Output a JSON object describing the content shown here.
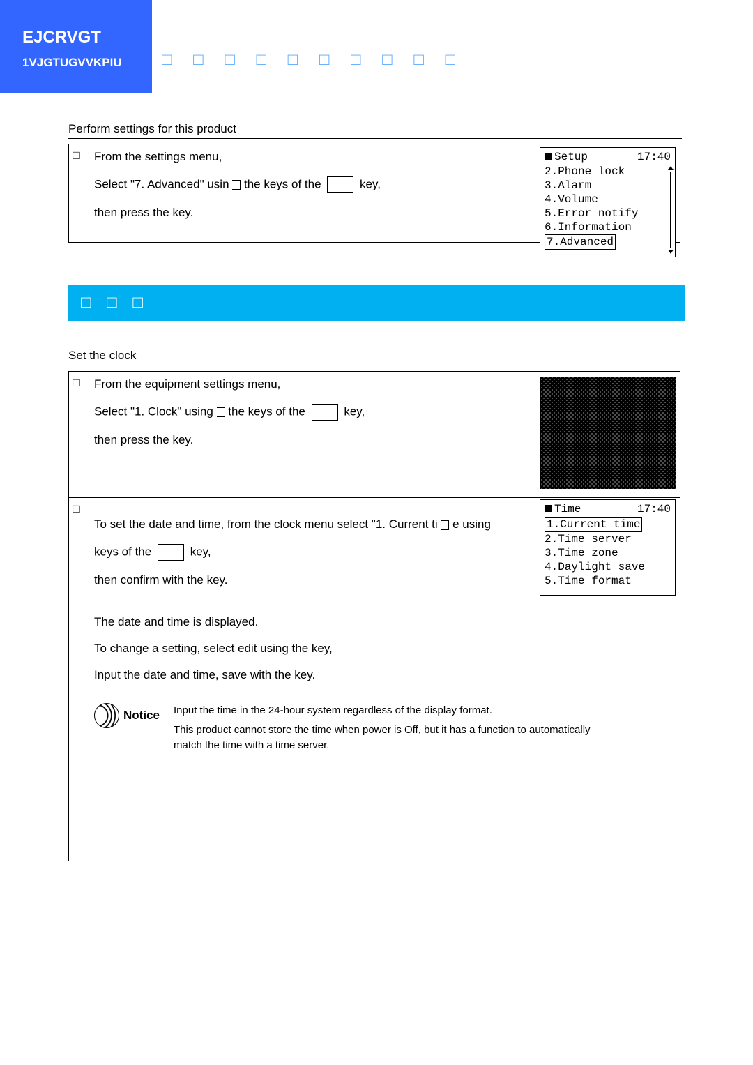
{
  "header": {
    "chapter_garbled": "EJCRVGT\u0019",
    "sub_garbled": "1VJGT\u0002UGVVKPIU"
  },
  "heading_boxes": "□ □ □ □ □ □ □ □ □ □",
  "section1": {
    "intro": "Perform settings for this product",
    "step_num": "□",
    "line1": "From the settings menu,",
    "line2a": "Select \"7. Advanced\" usin",
    "line2b": "the keys of the",
    "line2c": "key,",
    "line3": "then press the  key.",
    "phone": {
      "title": "Setup",
      "time": "17:40",
      "items": [
        "2.Phone lock",
        "3.Alarm",
        "4.Volume",
        "5.Error notify",
        "6.Information",
        "7.Advanced"
      ]
    }
  },
  "clock_bar": "□ □ □",
  "section2": {
    "intro": "Set the clock",
    "row1": {
      "num": "□",
      "line1": "From the equipment settings menu,",
      "line2a": "Select \"1. Clock\" using",
      "line2b": "the keys of the",
      "line2c": "key,",
      "line3": "then press the  key."
    },
    "row2": {
      "num": "□",
      "line1a": "To set the date and time, from the clock menu select \"1. Current ti",
      "line1b": "e using",
      "line2a": "keys of the",
      "line2b": "key,",
      "line3": "then confirm with the key.",
      "line4": "The date and time is displayed.",
      "line5": "To change a setting, select   edit  using the key,",
      "line6": "Input the date and time, save with the key.",
      "notice_label": "Notice",
      "notice1": "Input the time in the 24-hour system regardless of the display format.",
      "notice2": "This product cannot store the time when power is Off, but it has a function to automatically match the time with a time server.",
      "phone": {
        "title": "Time",
        "time": "17:40",
        "items": [
          "1.Current time",
          "2.Time server",
          "3.Time zone",
          "4.Daylight save",
          "5.Time format"
        ]
      }
    }
  }
}
